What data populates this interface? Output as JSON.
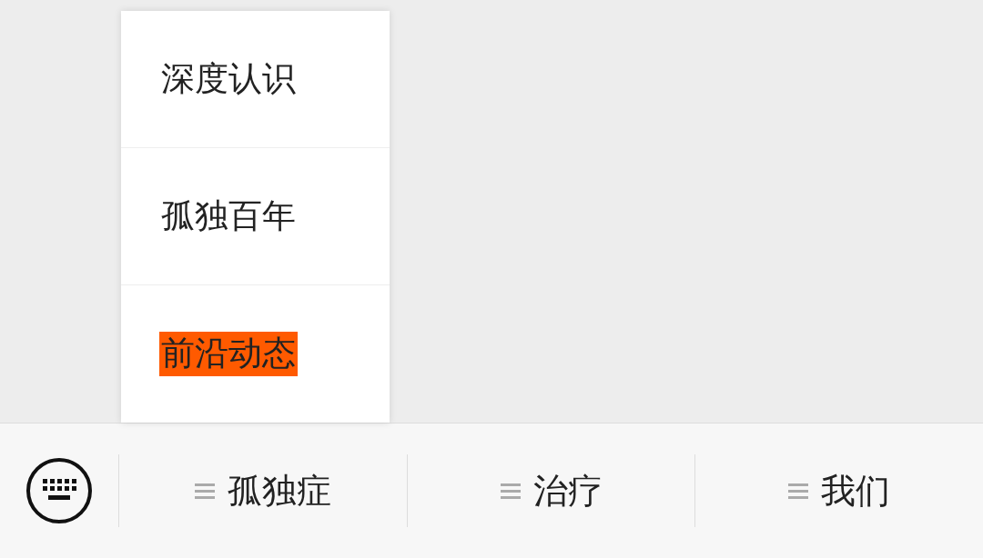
{
  "submenu": {
    "items": [
      {
        "label": "深度认识",
        "selected": false
      },
      {
        "label": "孤独百年",
        "selected": false
      },
      {
        "label": "前沿动态",
        "selected": true
      }
    ]
  },
  "menu_bar": {
    "tabs": [
      {
        "label": "孤独症"
      },
      {
        "label": "治疗"
      },
      {
        "label": "我们"
      }
    ]
  }
}
